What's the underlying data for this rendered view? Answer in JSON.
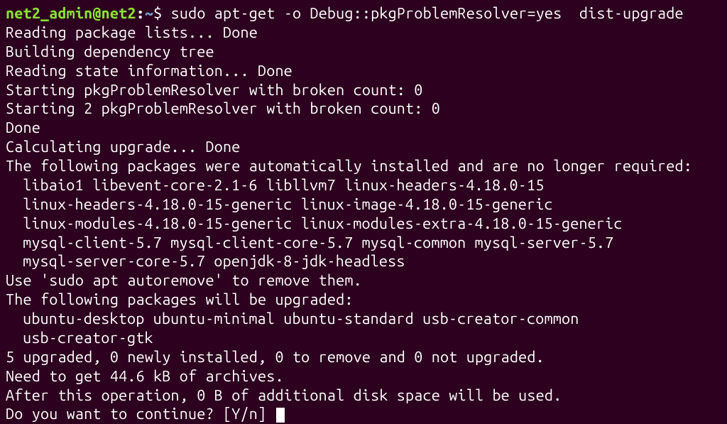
{
  "prompt": {
    "user": "net2_admin",
    "at": "@",
    "host": "net2",
    "colon": ":",
    "path": "~",
    "dollar": "$ ",
    "command": "sudo apt-get -o Debug::pkgProblemResolver=yes  dist-upgrade"
  },
  "out": {
    "l1": "Reading package lists... Done",
    "l2": "Building dependency tree",
    "l3": "Reading state information... Done",
    "l4": "Starting pkgProblemResolver with broken count: 0",
    "l5": "Starting 2 pkgProblemResolver with broken count: 0",
    "l6": "Done",
    "l7": "Calculating upgrade... Done",
    "l8": "The following packages were automatically installed and are no longer required:",
    "l9": "libaio1 libevent-core-2.1-6 libllvm7 linux-headers-4.18.0-15",
    "l10": "linux-headers-4.18.0-15-generic linux-image-4.18.0-15-generic",
    "l11": "linux-modules-4.18.0-15-generic linux-modules-extra-4.18.0-15-generic",
    "l12": "mysql-client-5.7 mysql-client-core-5.7 mysql-common mysql-server-5.7",
    "l13": "mysql-server-core-5.7 openjdk-8-jdk-headless",
    "l14": "Use 'sudo apt autoremove' to remove them.",
    "l15": "The following packages will be upgraded:",
    "l16": "ubuntu-desktop ubuntu-minimal ubuntu-standard usb-creator-common",
    "l17": "usb-creator-gtk",
    "l18": "5 upgraded, 0 newly installed, 0 to remove and 0 not upgraded.",
    "l19": "Need to get 44.6 kB of archives.",
    "l20": "After this operation, 0 B of additional disk space will be used.",
    "l21": "Do you want to continue? [Y/n] "
  }
}
